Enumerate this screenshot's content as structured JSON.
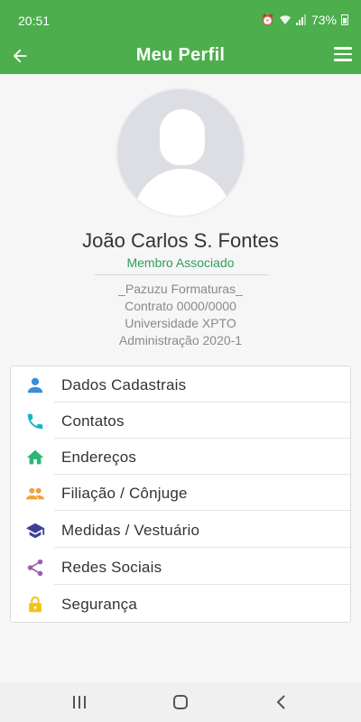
{
  "status_bar": {
    "time": "20:51",
    "battery": "73%"
  },
  "app_bar": {
    "title": "Meu Perfil"
  },
  "profile": {
    "name": "João Carlos S. Fontes",
    "role": "Membro Associado",
    "info": [
      "_Pazuzu Formaturas_",
      "Contrato 0000/0000",
      "Universidade XPTO",
      "Administração 2020-1"
    ]
  },
  "menu": {
    "items": [
      {
        "label": "Dados Cadastrais",
        "icon": "person-icon",
        "color": "#3a8fd6"
      },
      {
        "label": "Contatos",
        "icon": "phone-icon",
        "color": "#1ab2c8"
      },
      {
        "label": "Endereços",
        "icon": "home-icon",
        "color": "#2bb673"
      },
      {
        "label": "Filiação / Cônjuge",
        "icon": "people-icon",
        "color": "#f0a33a"
      },
      {
        "label": "Medidas / Vestuário",
        "icon": "graduation-cap-icon",
        "color": "#3c3f99"
      },
      {
        "label": "Redes Sociais",
        "icon": "share-icon",
        "color": "#a05bb5"
      },
      {
        "label": "Segurança",
        "icon": "lock-icon",
        "color": "#f2c21b"
      }
    ]
  },
  "colors": {
    "accent": "#4cae4c",
    "role_text": "#2e9e5b"
  }
}
